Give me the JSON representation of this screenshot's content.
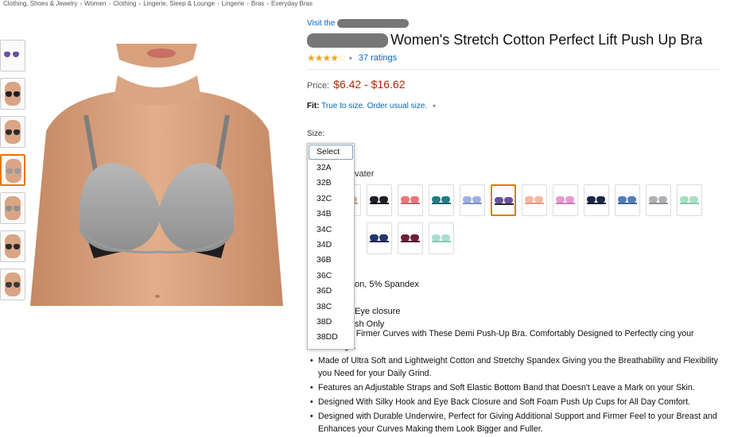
{
  "breadcrumb": [
    "Clothing, Shoes & Jewelry",
    "Women",
    "Clothing",
    "Lingerie, Sleep & Lounge",
    "Lingerie",
    "Bras",
    "Everyday Bras"
  ],
  "product": {
    "visit_label": "Visit the",
    "title": "Women's Stretch Cotton Perfect Lift Push Up Bra",
    "stars_full": "★★★★",
    "stars_empty": "☆",
    "rating_value": 4.1,
    "rating_count": "37 ratings",
    "price_label": "Price:",
    "price": "$6.42 - $16.62",
    "fit_label": "Fit:",
    "fit_text": "True to size. Order usual size.",
    "size_label": "Size:"
  },
  "size_dropdown": {
    "options": [
      "Select",
      "32A",
      "32B",
      "32C",
      "34B",
      "34C",
      "34D",
      "36B",
      "36C",
      "36D",
      "38C",
      "38D",
      "38DD"
    ],
    "selected": "Select"
  },
  "color": {
    "label_fragment": "vater",
    "swatches": [
      {
        "cup": "#d4b59a",
        "band": "#c49e80"
      },
      {
        "cup": "#1e1e26",
        "band": "#111"
      },
      {
        "cup": "#e9777a",
        "band": "#d25f66"
      },
      {
        "cup": "#1f7e84",
        "band": "#16666b"
      },
      {
        "cup": "#9fb1e0",
        "band": "#7d8fc8"
      },
      {
        "cup": "#6b4fa0",
        "band": "#2b2b2b",
        "selected": true
      },
      {
        "cup": "#f4b9a0",
        "band": "#e79c80"
      },
      {
        "cup": "#e69ad1",
        "band": "#cf7ab9"
      },
      {
        "cup": "#1c2647",
        "band": "#101a35"
      },
      {
        "cup": "#4f7fb8",
        "band": "#3d689c"
      },
      {
        "cup": "#b0b0b4",
        "band": "#8e8e94"
      },
      {
        "cup": "#a7e0c7",
        "band": "#86c9ad"
      },
      {
        "cup": "#26356b",
        "band": "#1a2553"
      },
      {
        "cup": "#6e1f3b",
        "band": "#55152c"
      },
      {
        "cup": "#a7ded0",
        "band": "#83c7b5"
      }
    ]
  },
  "material_fragment": "on, 5% Spandex",
  "detail_fragments": [
    "Eye closure",
    "sh Only"
  ],
  "bullets": [
    "ident with Firmer Curves with These Demi Push-Up Bra. Comfortably Designed to Perfectly cing your Cleavage.",
    "Made of Ultra Soft and Lightweight Cotton and Stretchy Spandex Giving you the Breathability and Flexibility you Need for your Daily Grind.",
    "Features an Adjustable Straps and Soft Elastic Bottom Band that Doesn't Leave a Mark on your Skin.",
    "Designed With Silky Hook and Eye Back Closure and Soft Foam Push Up Cups for All Day Comfort.",
    "Designed with Durable Underwire, Perfect for Giving Additional Support and Firmer Feel to your Breast and Enhances your Curves Making them Look Bigger and Fuller."
  ],
  "thumbnails": [
    {
      "kind": "flat",
      "cup": "#6b4fa0"
    },
    {
      "kind": "model",
      "cup": "#1e1e26"
    },
    {
      "kind": "model",
      "cup": "#2b2b30"
    },
    {
      "kind": "model",
      "cup": "#9b9b9b",
      "selected": true
    },
    {
      "kind": "model",
      "cup": "#8f8f8f"
    },
    {
      "kind": "model",
      "cup": "#2a2a2a"
    },
    {
      "kind": "model",
      "cup": "#3a3a3a"
    }
  ],
  "main_image": {
    "alt": "Model wearing gray stretch cotton push up bra"
  }
}
